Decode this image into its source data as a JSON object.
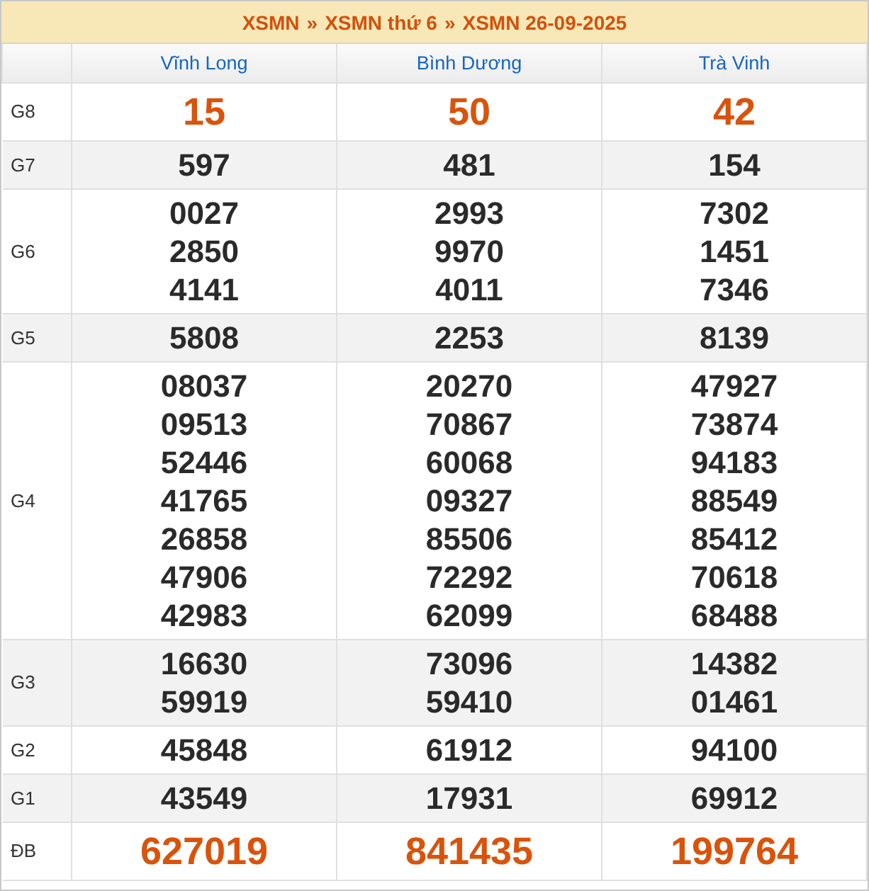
{
  "breadcrumb": {
    "items": [
      "XSMN",
      "XSMN thứ 6",
      "XSMN 26-09-2025"
    ],
    "separator": "»"
  },
  "provinces": [
    "Vĩnh Long",
    "Bình Dương",
    "Trà Vinh"
  ],
  "prizes": [
    {
      "label": "G8",
      "kind": "highlight",
      "results": [
        [
          "15"
        ],
        [
          "50"
        ],
        [
          "42"
        ]
      ]
    },
    {
      "label": "G7",
      "kind": "normal",
      "results": [
        [
          "597"
        ],
        [
          "481"
        ],
        [
          "154"
        ]
      ]
    },
    {
      "label": "G6",
      "kind": "normal",
      "results": [
        [
          "0027",
          "2850",
          "4141"
        ],
        [
          "2993",
          "9970",
          "4011"
        ],
        [
          "7302",
          "1451",
          "7346"
        ]
      ]
    },
    {
      "label": "G5",
      "kind": "normal",
      "results": [
        [
          "5808"
        ],
        [
          "2253"
        ],
        [
          "8139"
        ]
      ]
    },
    {
      "label": "G4",
      "kind": "normal",
      "results": [
        [
          "08037",
          "09513",
          "52446",
          "41765",
          "26858",
          "47906",
          "42983"
        ],
        [
          "20270",
          "70867",
          "60068",
          "09327",
          "85506",
          "72292",
          "62099"
        ],
        [
          "47927",
          "73874",
          "94183",
          "88549",
          "85412",
          "70618",
          "68488"
        ]
      ]
    },
    {
      "label": "G3",
      "kind": "normal",
      "results": [
        [
          "16630",
          "59919"
        ],
        [
          "73096",
          "59410"
        ],
        [
          "14382",
          "01461"
        ]
      ]
    },
    {
      "label": "G2",
      "kind": "normal",
      "results": [
        [
          "45848"
        ],
        [
          "61912"
        ],
        [
          "94100"
        ]
      ]
    },
    {
      "label": "G1",
      "kind": "normal",
      "results": [
        [
          "43549"
        ],
        [
          "17931"
        ],
        [
          "69912"
        ]
      ]
    },
    {
      "label": "ĐB",
      "kind": "highlight",
      "results": [
        [
          "627019"
        ],
        [
          "841435"
        ],
        [
          "199764"
        ]
      ]
    }
  ]
}
